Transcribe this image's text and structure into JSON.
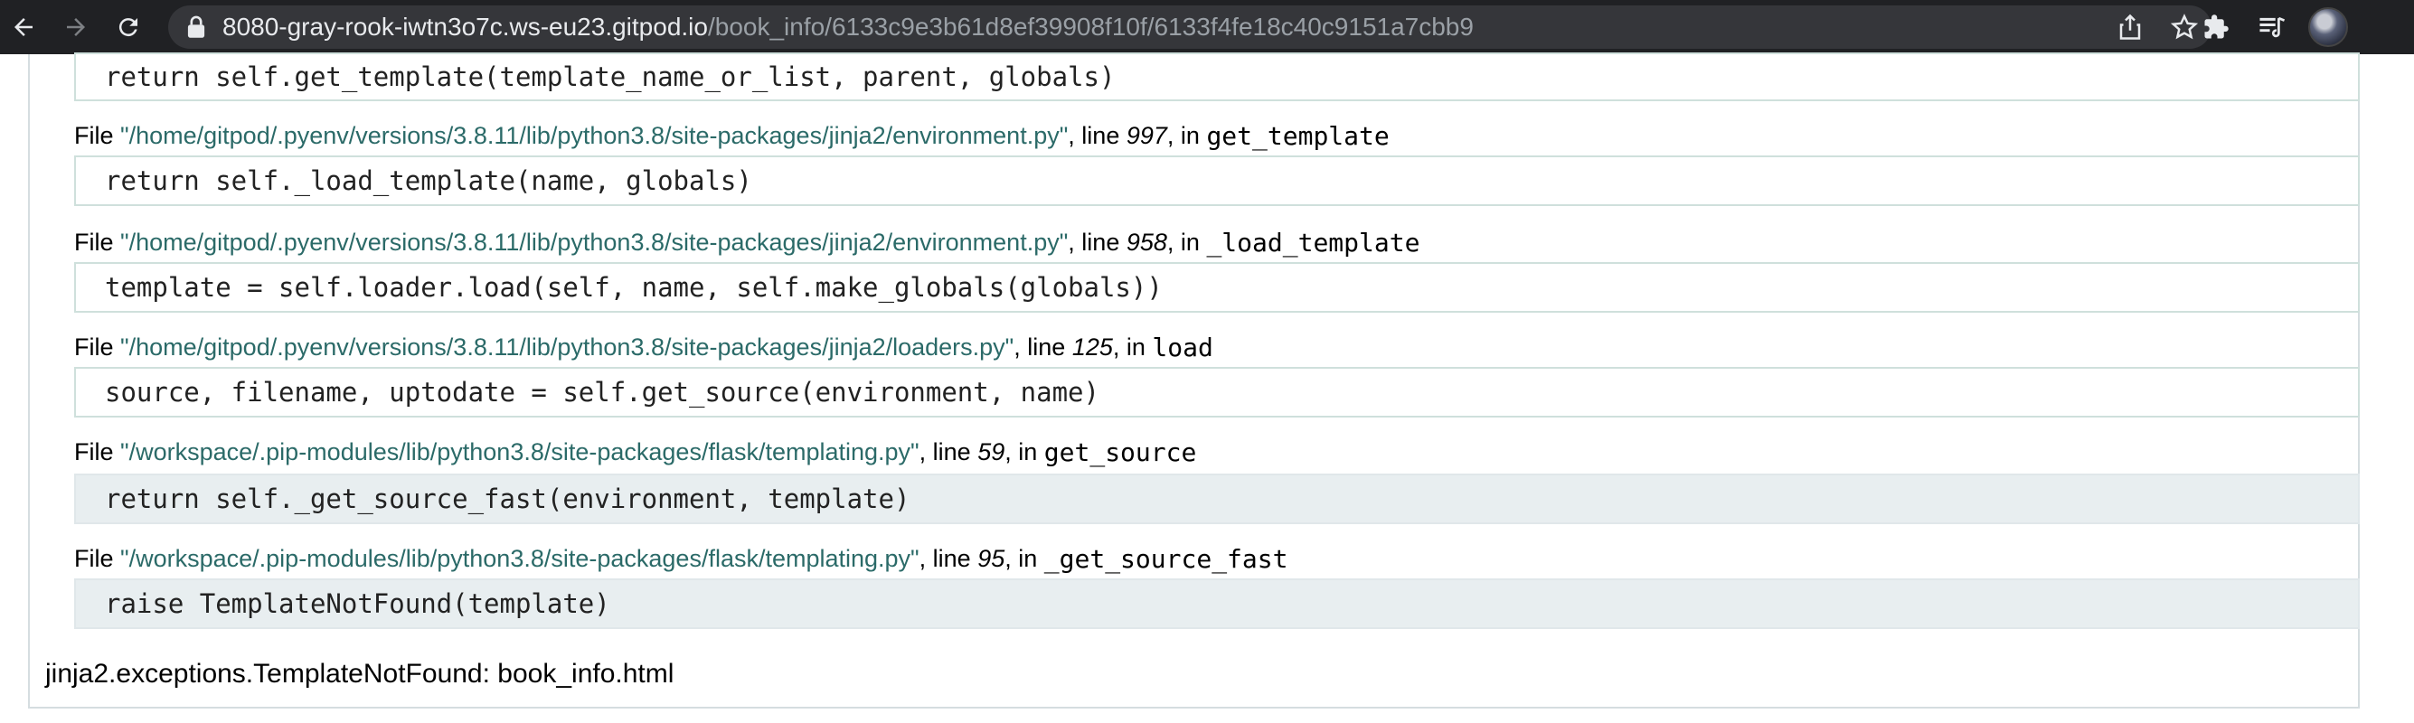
{
  "browser": {
    "url_host": "8080-gray-rook-iwtn3o7c.ws-eu23.gitpod.io",
    "url_path": "/book_info/6133c9e3b61d8ef39908f10f/6133f4fe18c40c9151a7cbb9",
    "icons": [
      "back-arrow-icon",
      "forward-arrow-icon",
      "reload-icon",
      "lock-icon",
      "share-icon",
      "star-icon",
      "extensions-icon",
      "reading-list-icon",
      "profile-avatar"
    ]
  },
  "traceback": {
    "file_label": "File ",
    "line_label": ", line ",
    "in_label": ", in ",
    "top_code": "return self.get_template(template_name_or_list, parent, globals)",
    "frames": [
      {
        "path": "\"/home/gitpod/.pyenv/versions/3.8.11/lib/python3.8/site-packages/jinja2/environment.py\"",
        "line": "997",
        "func": "get_template",
        "code": "return self._load_template(name, globals)"
      },
      {
        "path": "\"/home/gitpod/.pyenv/versions/3.8.11/lib/python3.8/site-packages/jinja2/environment.py\"",
        "line": "958",
        "func": "_load_template",
        "code": "template = self.loader.load(self, name, self.make_globals(globals))"
      },
      {
        "path": "\"/home/gitpod/.pyenv/versions/3.8.11/lib/python3.8/site-packages/jinja2/loaders.py\"",
        "line": "125",
        "func": "load",
        "code": "source, filename, uptodate = self.get_source(environment, name)"
      },
      {
        "path": "\"/workspace/.pip-modules/lib/python3.8/site-packages/flask/templating.py\"",
        "line": "59",
        "func": "get_source",
        "code": "return self._get_source_fast(environment, template)"
      },
      {
        "path": "\"/workspace/.pip-modules/lib/python3.8/site-packages/flask/templating.py\"",
        "line": "95",
        "func": "_get_source_fast",
        "code": "raise TemplateNotFound(template)"
      }
    ],
    "error": "jinja2.exceptions.TemplateNotFound: book_info.html"
  }
}
